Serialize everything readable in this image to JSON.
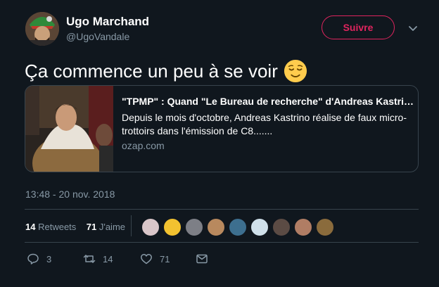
{
  "user": {
    "name": "Ugo Marchand",
    "handle": "@UgoVandale",
    "follow_label": "Suivre"
  },
  "tweet": {
    "text": "Ça commence un peu à se voir"
  },
  "card": {
    "title": "\"TPMP\" : Quand \"Le Bureau de recherche\" d'Andreas Kastrino",
    "description": "Depuis le mois d'octobre, Andreas Kastrino réalise de faux micro-trottoirs dans l'émission de C8.......",
    "domain": "ozap.com"
  },
  "timestamp": "13:48 - 20 nov. 2018",
  "stats": {
    "retweets_count": "14",
    "retweets_label": "Retweets",
    "likes_count": "71",
    "likes_label": "J'aime"
  },
  "actions": {
    "reply_count": "3",
    "retweet_count": "14",
    "like_count": "71"
  },
  "colors": {
    "background": "#10171e",
    "accent": "#e0245e",
    "secondary_text": "#8899a6",
    "border": "#38444d"
  },
  "icons": [
    "reply-icon",
    "retweet-icon",
    "heart-icon",
    "mail-icon",
    "chevron-down-icon",
    "relieved-face-emoji"
  ]
}
